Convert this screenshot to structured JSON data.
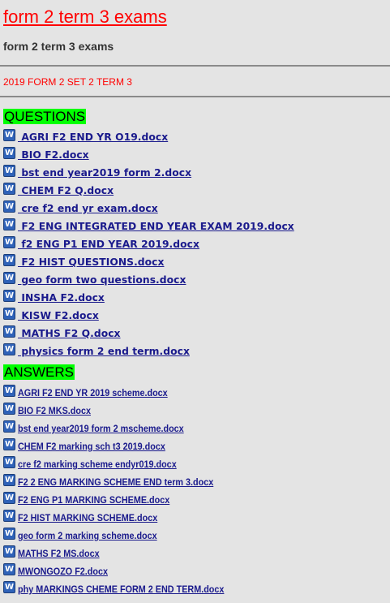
{
  "page": {
    "title": "form 2 term 3 exams",
    "subtitle": "form 2 term 3 exams",
    "set_title": "2019 FORM 2 SET 2 TERM 3"
  },
  "icons": {
    "file_icon": "word-doc-icon",
    "file_icon_glyph": "W",
    "file_icon_color": "#2f62b8"
  },
  "colors": {
    "title": "#ff0000",
    "section_highlight": "#00ff00",
    "link": "#1a1a8c",
    "background": "#e4e4e4"
  },
  "questions": {
    "heading": "QUESTIONS",
    "files": [
      " AGRI F2 END YR O19.docx",
      " BIO F2.docx",
      " bst end year2019 form 2.docx",
      " CHEM F2 Q.docx",
      " cre f2 end yr exam.docx",
      " F2 ENG INTEGRATED END YEAR EXAM 2019.docx",
      " f2 ENG P1 END YEAR 2019.docx",
      " F2 HIST QUESTIONS.docx",
      " geo form two questions.docx",
      " INSHA F2.docx",
      " KISW F2.docx",
      " MATHS F2 Q.docx",
      " physics form 2 end term.docx"
    ]
  },
  "answers": {
    "heading": "ANSWERS",
    "files": [
      "AGRI F2 END YR 2019 scheme.docx",
      "BIO F2 MKS.docx",
      "bst end year2019 form 2 mscheme.docx",
      "CHEM F2 marking sch t3 2019.docx",
      "cre f2 marking scheme endyr019.docx",
      "F2 2 ENG MARKING SCHEME END term 3.docx",
      "F2 ENG P1 MARKING SCHEME.docx",
      "F2 HIST MARKING SCHEME.docx",
      "geo form 2 marking scheme.docx",
      "MATHS F2 MS.docx",
      "MWONGOZO F2.docx",
      "phy MARKINGS CHEME FORM 2 END TERM.docx"
    ]
  }
}
